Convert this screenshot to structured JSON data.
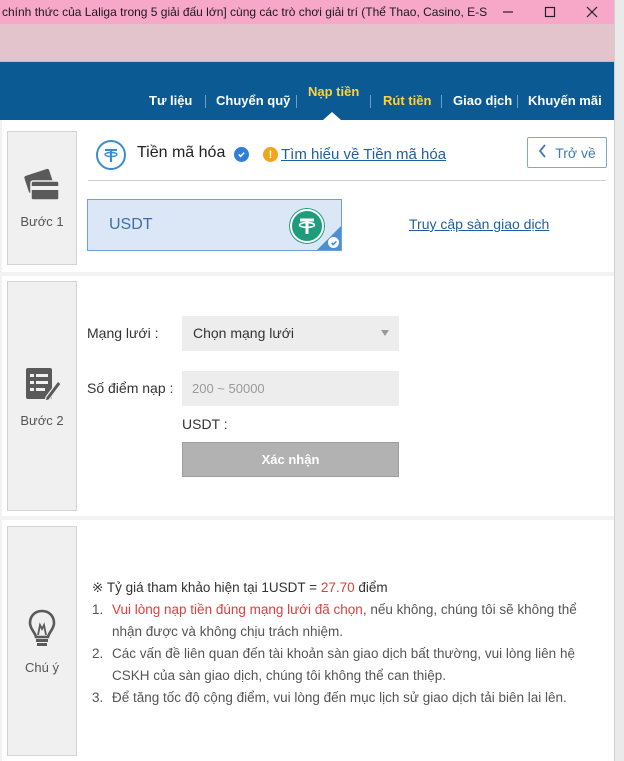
{
  "window": {
    "title": "chính thức của Laliga trong 5 giải đấu lớn] cùng các trò chơi giải trí (Thể Thao, Casino, E-S...",
    "minimize_icon": "minimize-icon",
    "maximize_icon": "maximize-icon",
    "close_icon": "close-icon"
  },
  "nav": {
    "items": [
      {
        "label": "Tư liệu"
      },
      {
        "label": "Chuyển quỹ"
      },
      {
        "label": "Nạp tiền"
      },
      {
        "label": "Rút tiền"
      },
      {
        "label": "Giao dịch"
      },
      {
        "label": "Khuyến mãi"
      }
    ],
    "active_index": 2,
    "accent_color": "#ffd23a",
    "background": "#0b5a94"
  },
  "step1": {
    "label": "Bước 1",
    "icon": "credit-card-icon",
    "title": "Tiền mã hóa",
    "learn_link": "Tìm hiểu về Tiền mã hóa",
    "back_label": "Trở về",
    "selected_coin": "USDT",
    "exchange_link": "Truy cập sàn giao dịch"
  },
  "step2": {
    "label": "Bước 2",
    "icon": "form-edit-icon",
    "network_label": "Mạng lưới :",
    "network_value": "Chọn mạng lưới",
    "amount_label": "Số điểm nạp :",
    "amount_placeholder": "200 ~ 50000",
    "currency_label": "USDT :",
    "confirm_label": "Xác nhận"
  },
  "notes": {
    "label": "Chú ý",
    "icon": "lightbulb-icon",
    "rate_prefix": "※ Tỷ giá tham khảo hiện tại 1USDT = ",
    "rate_value": "27.70",
    "rate_suffix": " điểm",
    "items": [
      {
        "num": "1.",
        "highlight": "Vui lòng nạp tiền đúng mạng lưới đã chọn",
        "text": ", nếu không, chúng tôi sẽ không thể nhận được và không chịu trách nhiệm."
      },
      {
        "num": "2.",
        "text": "Các vấn đề liên quan đến tài khoản sàn giao dịch bất thường, vui lòng liên hệ CSKH của sàn giao dịch, chúng tôi không thể can thiệp."
      },
      {
        "num": "3.",
        "text": "Để tăng tốc độ cộng điểm, vui lòng đến mục lịch sử giao dịch tải biên lai lên."
      }
    ]
  }
}
